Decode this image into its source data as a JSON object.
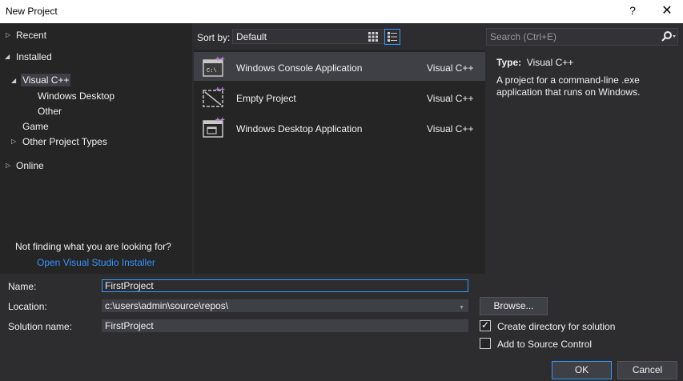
{
  "window": {
    "title": "New Project",
    "help": "?",
    "close": "✕"
  },
  "tree": {
    "recent": "Recent",
    "installed": "Installed",
    "visual_cpp": "Visual C++",
    "windows_desktop": "Windows Desktop",
    "other": "Other",
    "game": "Game",
    "other_project_types": "Other Project Types",
    "online": "Online"
  },
  "not_finding": {
    "text": "Not finding what you are looking for?",
    "link": "Open Visual Studio Installer"
  },
  "sort": {
    "label": "Sort by:",
    "value": "Default"
  },
  "search": {
    "placeholder": "Search (Ctrl+E)"
  },
  "templates": [
    {
      "name": "Windows Console Application",
      "lang": "Visual C++",
      "selected": true
    },
    {
      "name": "Empty Project",
      "lang": "Visual C++",
      "selected": false
    },
    {
      "name": "Windows Desktop Application",
      "lang": "Visual C++",
      "selected": false
    }
  ],
  "info": {
    "type_label": "Type:",
    "type_value": "Visual C++",
    "description": "A project for a command-line .exe application that runs on Windows."
  },
  "form": {
    "name_label": "Name:",
    "name_value": "FirstProject",
    "location_label": "Location:",
    "location_value": "c:\\users\\admin\\source\\repos\\",
    "solution_label": "Solution name:",
    "solution_value": "FirstProject",
    "browse": "Browse...",
    "create_dir": "Create directory for solution",
    "create_dir_checked": true,
    "source_control": "Add to Source Control",
    "source_control_checked": false,
    "ok": "OK",
    "cancel": "Cancel"
  },
  "colors": {
    "accent": "#3399ff",
    "link": "#3794ff",
    "background": "#2d2d30",
    "pane": "#252526"
  }
}
